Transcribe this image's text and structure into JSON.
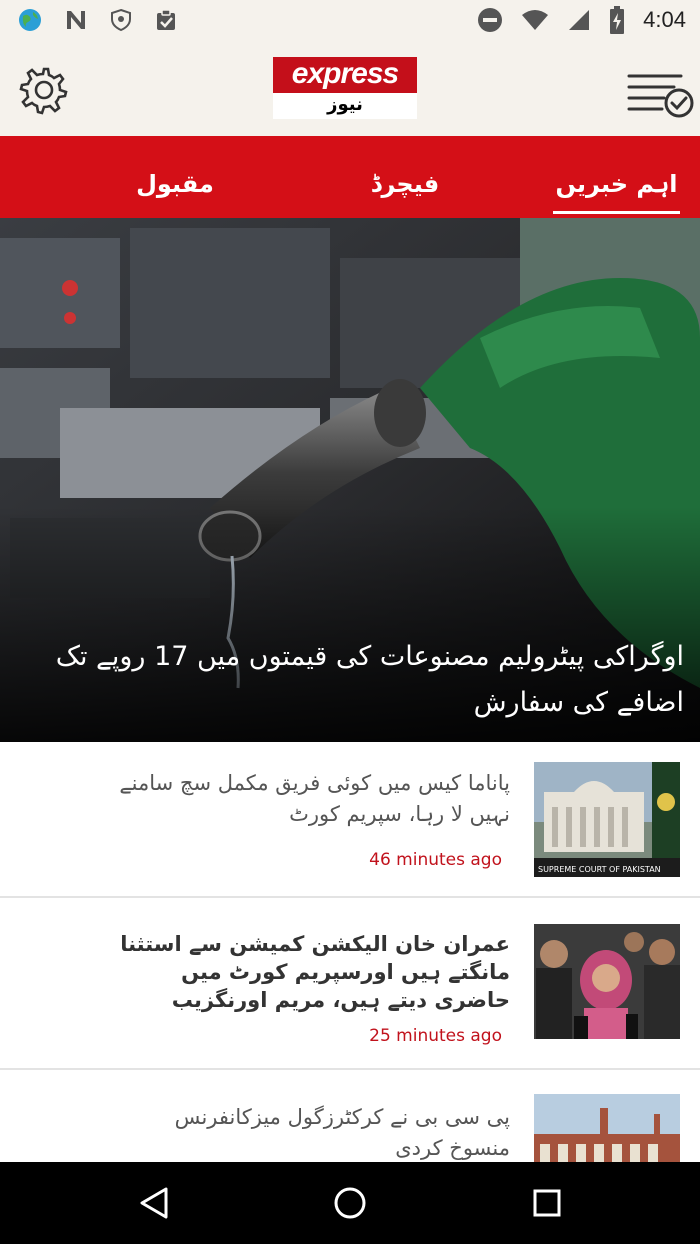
{
  "status_bar": {
    "time": "4:04",
    "left_icons": [
      "globe-icon",
      "n-app-icon",
      "shield-icon",
      "clipboard-check-icon"
    ],
    "right_icons": [
      "dnd-icon",
      "wifi-icon",
      "signal-icon",
      "battery-charging-icon"
    ]
  },
  "header": {
    "logo_top": "express",
    "logo_bottom": "نیوز",
    "settings_icon": "gear-icon",
    "menu_icon": "list-check-icon"
  },
  "tabs": [
    {
      "label": "اہم خبریں",
      "active": true
    },
    {
      "label": "فیچرڈ",
      "active": false
    },
    {
      "label": "مقبول",
      "active": false
    }
  ],
  "hero": {
    "headline": "اوگراکی پیٹرولیم مصنوعات کی قیمتوں میں 17 روپے تک اضافے کی سفارش"
  },
  "news": [
    {
      "headline": "پاناما کیس میں کوئی فریق مکمل سچ سامنے نہیں لا رہا، سپریم کورٹ",
      "time": "46 minutes ago",
      "thumb_caption": "SUPREME COURT OF PAKISTAN"
    },
    {
      "headline": "عمران خان الیکشن کمیشن سے استثنا مانگتے ہیں اورسپریم کورٹ میں حاضری دیتے ہیں، مریم اورنگزیب",
      "time": "25 minutes ago",
      "thumb_caption": ""
    },
    {
      "headline": "پی سی بی نے کرکٹرزگول میزکانفرنس منسوخ کردی",
      "time": "",
      "thumb_caption": ""
    }
  ],
  "nav_bar": {
    "icons": [
      "back-icon",
      "home-icon",
      "recents-icon"
    ]
  },
  "colors": {
    "brand_red": "#d40f17",
    "time_red": "#c1121c",
    "header_bg": "#f5f2ec"
  }
}
